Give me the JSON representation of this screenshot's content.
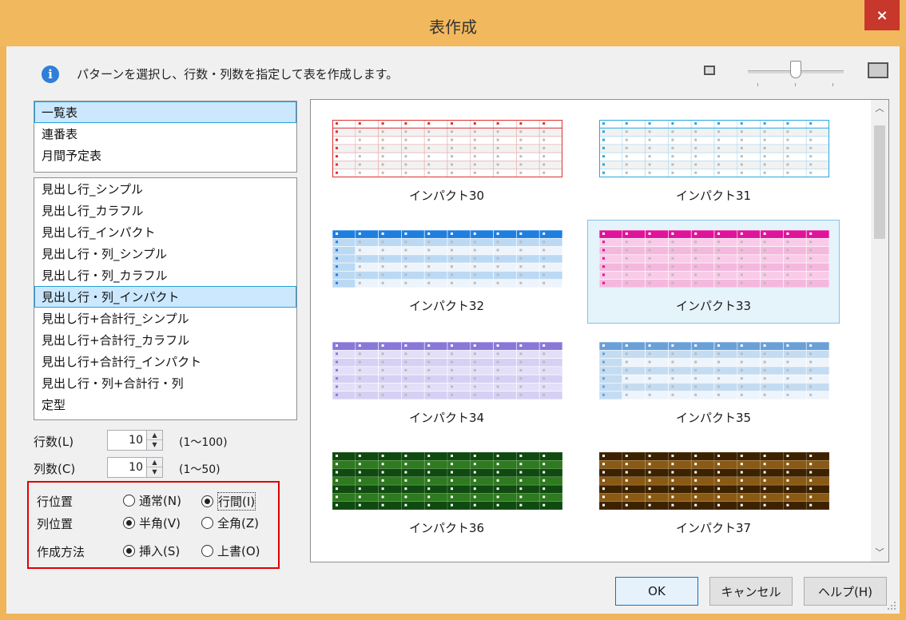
{
  "window": {
    "title": "表作成",
    "close_label": "×"
  },
  "info": {
    "icon": "info-icon",
    "icon_glyph": "i",
    "text": "パターンを選択し、行数・列数を指定して表を作成します。"
  },
  "zoom": {
    "level_fraction": 0.5
  },
  "category_list": {
    "items": [
      {
        "label": "一覧表",
        "selected": true
      },
      {
        "label": "連番表",
        "selected": false
      },
      {
        "label": "月間予定表",
        "selected": false
      }
    ]
  },
  "style_list": {
    "items": [
      {
        "label": "見出し行_シンプル",
        "selected": false
      },
      {
        "label": "見出し行_カラフル",
        "selected": false
      },
      {
        "label": "見出し行_インパクト",
        "selected": false
      },
      {
        "label": "見出し行・列_シンプル",
        "selected": false
      },
      {
        "label": "見出し行・列_カラフル",
        "selected": false
      },
      {
        "label": "見出し行・列_インパクト",
        "selected": true
      },
      {
        "label": "見出し行+合計行_シンプル",
        "selected": false
      },
      {
        "label": "見出し行+合計行_カラフル",
        "selected": false
      },
      {
        "label": "見出し行+合計行_インパクト",
        "selected": false
      },
      {
        "label": "見出し行・列+合計行・列",
        "selected": false
      },
      {
        "label": "定型",
        "selected": false
      }
    ]
  },
  "rows": {
    "label": "行数(L)",
    "value": "10",
    "range": "(1～100)"
  },
  "cols": {
    "label": "列数(C)",
    "value": "10",
    "range": "(1～50)"
  },
  "options": {
    "row_position": {
      "label": "行位置",
      "choices": [
        {
          "label": "通常(N)",
          "checked": false
        },
        {
          "label": "行間(I)",
          "checked": true
        }
      ]
    },
    "col_position": {
      "label": "列位置",
      "choices": [
        {
          "label": "半角(V)",
          "checked": true
        },
        {
          "label": "全角(Z)",
          "checked": false
        }
      ]
    },
    "method": {
      "label": "作成方法",
      "choices": [
        {
          "label": "挿入(S)",
          "checked": true
        },
        {
          "label": "上書(O)",
          "checked": false
        }
      ]
    }
  },
  "gallery": {
    "tiles": [
      {
        "caption": "インパクト30",
        "style": "outline",
        "header": "#e03030",
        "band": "#e8a8a8",
        "selected": false
      },
      {
        "caption": "インパクト31",
        "style": "outline",
        "header": "#2aa8e0",
        "band": "#a8d8f0",
        "selected": false
      },
      {
        "caption": "インパクト32",
        "style": "filled",
        "header": "#1e7fe0",
        "band": "#bcd9f3",
        "selected": false
      },
      {
        "caption": "インパクト33",
        "style": "filled",
        "header": "#e0149a",
        "band": "#f4b8de",
        "selected": true
      },
      {
        "caption": "インパクト34",
        "style": "filled",
        "header": "#8a78d8",
        "band": "#d6d0f4",
        "selected": false
      },
      {
        "caption": "インパクト35",
        "style": "filled",
        "header": "#6aa0d8",
        "band": "#c4dcf2",
        "selected": false
      },
      {
        "caption": "インパクト36",
        "style": "dark",
        "header": "#0f4a10",
        "band": "#2e7a1e",
        "selected": false
      },
      {
        "caption": "インパクト37",
        "style": "dark",
        "header": "#3d2200",
        "band": "#8a5a14",
        "selected": false
      }
    ]
  },
  "buttons": {
    "ok": "OK",
    "cancel": "キャンセル",
    "help": "ヘルプ(H)"
  },
  "colors": {
    "title_bar": "#f2b85e",
    "close_button": "#c7372b",
    "selection": "#cce8ff",
    "highlight_border": "#e00000"
  }
}
